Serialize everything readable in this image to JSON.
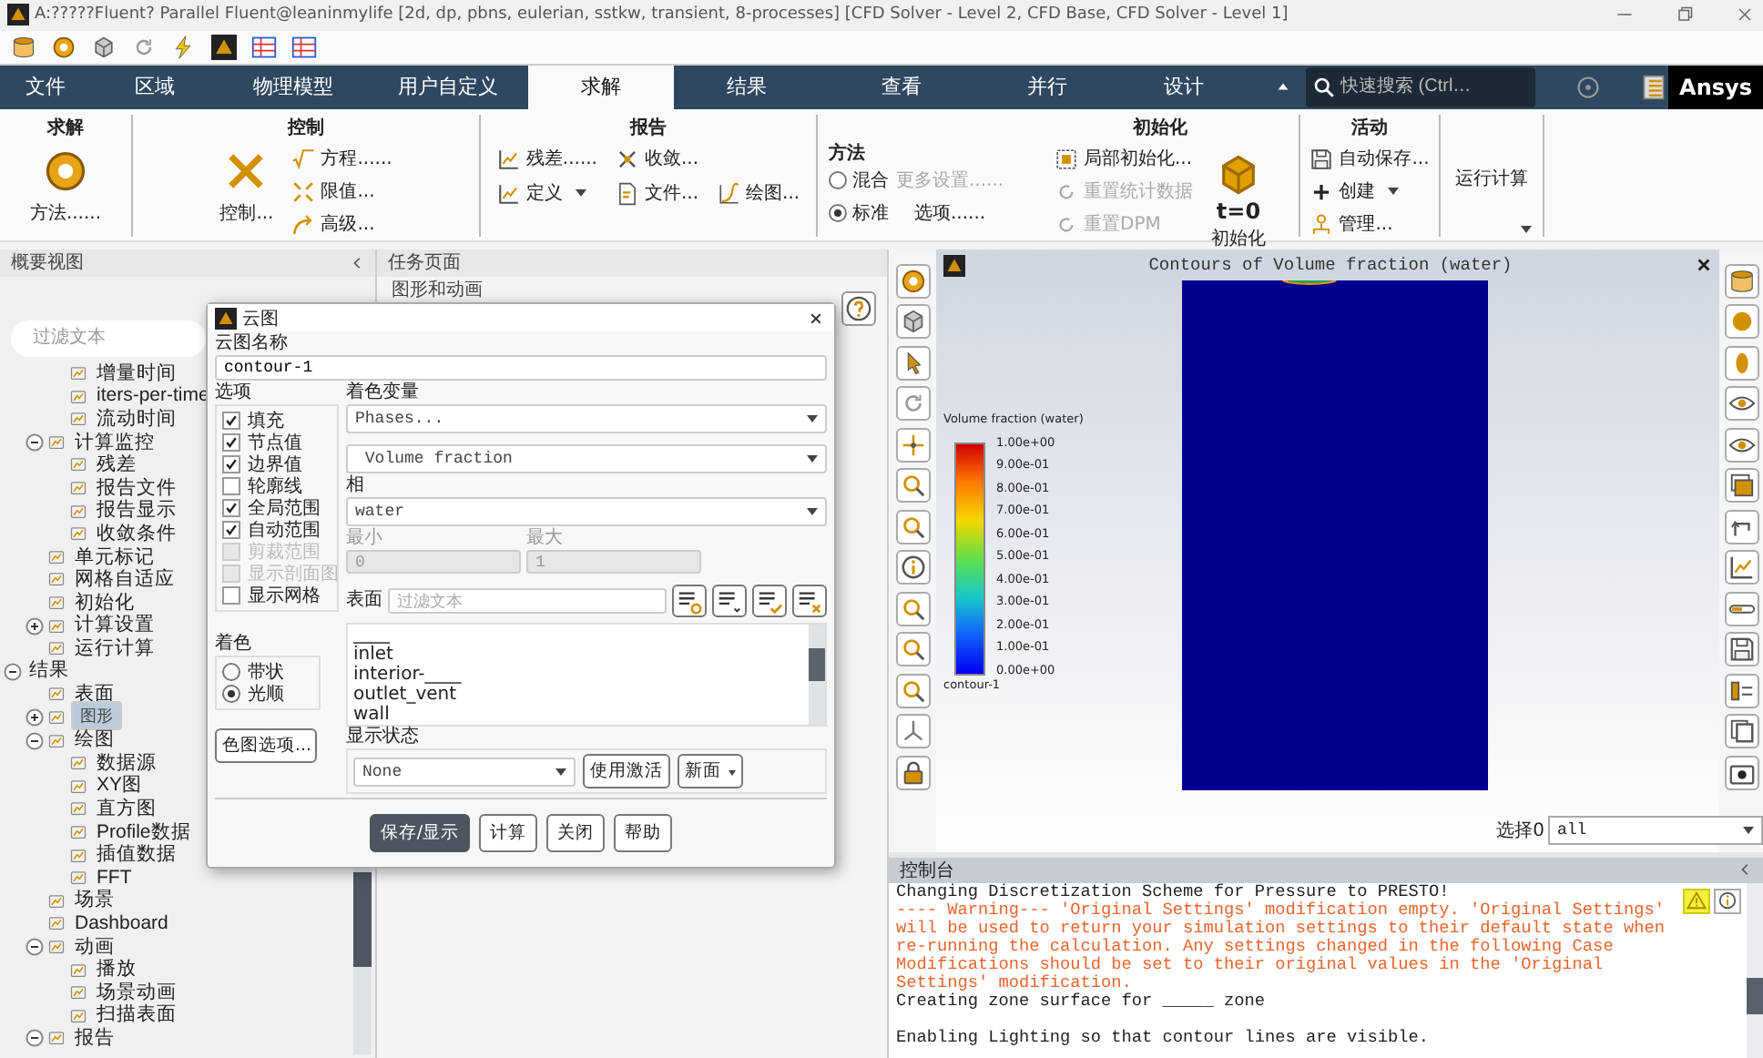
{
  "window": {
    "title": "A:?????Fluent? Parallel Fluent@leaninmylife  [2d, dp, pbns, eulerian, sstkw, transient, 8-processes] [CFD Solver - Level 2, CFD Base, CFD Solver - Level 1]"
  },
  "tabs": [
    {
      "label": "文件",
      "selected": false
    },
    {
      "label": "区域",
      "selected": false
    },
    {
      "label": "物理模型",
      "selected": false
    },
    {
      "label": "用户自定义",
      "selected": false
    },
    {
      "label": "求解",
      "selected": true
    },
    {
      "label": "结果",
      "selected": false
    },
    {
      "label": "查看",
      "selected": false
    },
    {
      "label": "并行",
      "selected": false
    },
    {
      "label": "设计",
      "selected": false
    }
  ],
  "search": {
    "placeholder": "快速搜索 (Ctrl…"
  },
  "logo": "Ansys",
  "ribbon": {
    "solution": {
      "title": "求解",
      "button": "方法......"
    },
    "controls": {
      "title": "控制",
      "button": "控制...",
      "items": [
        "方程......",
        "限值...",
        "高级..."
      ]
    },
    "reports": {
      "title": "报告",
      "items": [
        "残差......",
        "收敛...",
        "定义",
        "文件...",
        "绘图..."
      ]
    },
    "method": {
      "title": "方法",
      "options": [
        {
          "label": "混合",
          "selected": false
        },
        {
          "label": "标准",
          "selected": true
        }
      ],
      "more": {
        "label": "更多设置......",
        "disabled": true
      },
      "options_button": "选项......"
    },
    "initialization": {
      "title": "初始化",
      "items": [
        {
          "label": "局部初始化...",
          "disabled": false
        },
        {
          "label": "重置统计数据",
          "disabled": true
        },
        {
          "label": "重置DPM",
          "disabled": true
        }
      ],
      "icon_text": "t=0",
      "button": "初始化"
    },
    "activities": {
      "title": "活动",
      "items": [
        "自动保存...",
        "创建",
        "管理..."
      ]
    },
    "run": {
      "button": "运行计算"
    }
  },
  "outline": {
    "title": "概要视图",
    "filter_placeholder": "过滤文本",
    "tree": [
      {
        "children": [
          {
            "children": [
              {
                "label": "增量时间",
                "selected": false
              },
              {
                "label": "iters-per-time",
                "selected": false
              },
              {
                "label": "流动时间",
                "selected": false
              }
            ]
          },
          {
            "label": "计算监控",
            "selected": false,
            "expanded": true,
            "children": [
              {
                "label": "残差",
                "selected": false
              },
              {
                "label": "报告文件",
                "selected": false
              },
              {
                "label": "报告显示",
                "selected": false
              },
              {
                "label": "收敛条件",
                "selected": false
              }
            ]
          },
          {
            "label": "单元标记",
            "selected": false
          },
          {
            "label": "网格自适应",
            "selected": false
          },
          {
            "label": "初始化",
            "selected": false
          },
          {
            "label": "计算设置",
            "selected": false,
            "expanded": false
          },
          {
            "label": "运行计算",
            "selected": false
          }
        ]
      },
      {
        "label": "结果",
        "selected": false,
        "expanded": true,
        "children": [
          {
            "label": "表面",
            "selected": false
          },
          {
            "label": "图形",
            "selected": true,
            "expanded": false
          },
          {
            "label": "绘图",
            "selected": false,
            "expanded": true,
            "children": [
              {
                "label": "数据源",
                "selected": false
              },
              {
                "label": "XY图",
                "selected": false
              },
              {
                "label": "直方图",
                "selected": false
              },
              {
                "label": "Profile数据",
                "selected": false
              },
              {
                "label": "插值数据",
                "selected": false
              },
              {
                "label": "FFT",
                "selected": false
              }
            ]
          },
          {
            "label": "场景",
            "selected": false
          },
          {
            "label": "Dashboard",
            "selected": false
          },
          {
            "label": "动画",
            "selected": false,
            "expanded": true,
            "children": [
              {
                "label": "播放",
                "selected": false
              },
              {
                "label": "场景动画",
                "selected": false
              },
              {
                "label": "扫描表面",
                "selected": false
              }
            ]
          },
          {
            "label": "报告",
            "selected": false,
            "expanded": true
          }
        ]
      }
    ]
  },
  "task_page": {
    "title": "任务页面",
    "heading": "图形和动画"
  },
  "dialog": {
    "title": "云图",
    "name_label": "云图名称",
    "name_value": "contour-1",
    "options_label": "选项",
    "options": [
      {
        "label": "填充",
        "checked": true,
        "disabled": false
      },
      {
        "label": "节点值",
        "checked": true,
        "disabled": false
      },
      {
        "label": "边界值",
        "checked": true,
        "disabled": false
      },
      {
        "label": "轮廓线",
        "checked": false,
        "disabled": false
      },
      {
        "label": "全局范围",
        "checked": true,
        "disabled": false
      },
      {
        "label": "自动范围",
        "checked": true,
        "disabled": false
      },
      {
        "label": "剪裁范围",
        "checked": false,
        "disabled": true
      },
      {
        "label": "显示剖面图",
        "checked": false,
        "disabled": true
      },
      {
        "label": "显示网格",
        "checked": false,
        "disabled": false
      }
    ],
    "coloring_label": "着色",
    "coloring": [
      {
        "label": "带状",
        "selected": false
      },
      {
        "label": "光顺",
        "selected": true
      }
    ],
    "colormap_button": "色图选项...",
    "variable_label": "着色变量",
    "variable": "Phases...",
    "quantity": "Volume fraction",
    "phase_label": "相",
    "phase": "water",
    "min_label": "最小",
    "min_value": "0",
    "max_label": "最大",
    "max_value": "1",
    "surfaces_label": "表面",
    "surfaces_placeholder": "过滤文本",
    "surfaces": [
      "____",
      "inlet",
      "interior-____",
      "outlet_vent",
      "wall"
    ],
    "display_state_label": "显示状态",
    "display_state": "None",
    "use_active": "使用激活",
    "new_surface": "新面",
    "buttons": [
      {
        "label": "保存/显示",
        "kind": "primary"
      },
      {
        "label": "计算",
        "kind": "normal"
      },
      {
        "label": "关闭",
        "kind": "normal"
      },
      {
        "label": "帮助",
        "kind": "normal"
      }
    ]
  },
  "graphics": {
    "title": "Contours of Volume fraction (water)",
    "legend_title": "Volume fraction (water)",
    "legend_ticks": [
      "1.00e+00",
      "9.00e-01",
      "8.00e-01",
      "7.00e-01",
      "6.00e-01",
      "5.00e-01",
      "4.00e-01",
      "3.00e-01",
      "2.00e-01",
      "1.00e-01",
      "0.00e+00"
    ],
    "legend_caption": "contour-1",
    "select_label": "选择0",
    "select_value": "all"
  },
  "console": {
    "title": "控制台",
    "lines": [
      {
        "kind": "normal",
        "text": "Changing Discretization Scheme for Pressure to PRESTO!"
      },
      {
        "kind": "warning",
        "text": "---- Warning--- 'Original Settings' modification empty. 'Original Settings' will be used to return your simulation settings to their default state when re-running the calculation. Any settings changed in the following Case Modifications should be set to their original values in the 'Original Settings' modification."
      },
      {
        "kind": "normal",
        "text": "Creating zone surface for _____ zone"
      },
      {
        "kind": "normal",
        "text": "Enabling Lighting so that contour lines are visible."
      }
    ]
  }
}
